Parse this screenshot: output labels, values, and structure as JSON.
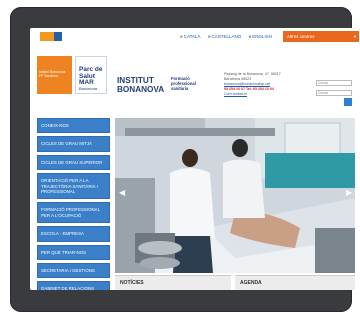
{
  "topbar": {
    "languages": [
      "CATALÀ",
      "CASTELLANO",
      "ENGLISH"
    ],
    "altres_label": "Altres centres",
    "altres_arrow": "▾"
  },
  "header": {
    "orange_block_text": "Institut Bonanova FP Sanitària",
    "park_big": "Parc de Salut MAR",
    "park_small": "Barcelona",
    "institute_title_line1": "INSTITUT",
    "institute_title_line2": "BONANOVA",
    "institute_sub_line1": "Formació",
    "institute_sub_line2": "professional",
    "institute_sub_line3": "sanitària",
    "contact_line1": "Passeig de la Bonanova, 47, 08017",
    "contact_line2": "Barcelona 08023",
    "contact_email": "bonanova@bonanovafsp.cat",
    "contact_phones": "93 254 16 07  Tel. 93 254 10 04",
    "contact_link": "Com arribar-hi",
    "search_placeholder1": "Cercar",
    "search_placeholder2": "Cercar"
  },
  "sidebar": {
    "items": [
      "CONEIX-NOS",
      "CICLES DE GRAU MITJÀ",
      "CICLES DE GRAU SUPERIOR",
      "ORIENTACIÓ PER A LA TRAJECTÒRIA SANITÀRIA I PROFESSIONAL",
      "FORMACIÓ PROFESSIONAL PER A L'OCUPACIÓ",
      "ESCOLA - EMPRESA",
      "PER QUÈ TRIAR-NOS",
      "SECRETARIA I GESTIONS",
      "GABINET DE RELACIONS INTERNACIONALS"
    ]
  },
  "main": {
    "arrow_left": "◀",
    "arrow_right": "▶"
  },
  "bottom": {
    "noticies": "NOTÍCIES",
    "agenda": "AGENDA"
  }
}
